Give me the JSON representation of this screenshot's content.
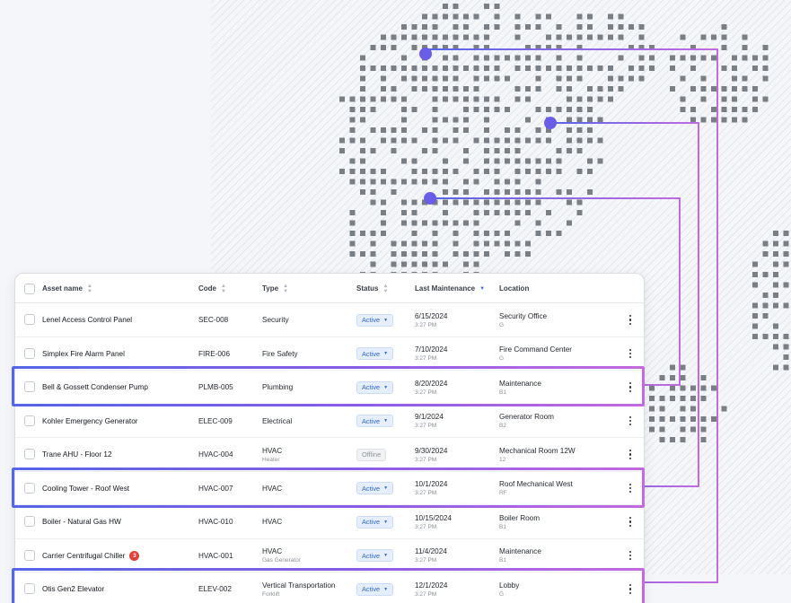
{
  "colors": {
    "accent_blue": "#5466e8",
    "accent_purple": "#9a5ce8",
    "status_active": "#2d67d6",
    "status_offline": "#8d939c",
    "alert_red": "#e4403a"
  },
  "table": {
    "headers": {
      "asset_name": "Asset name",
      "code": "Code",
      "type": "Type",
      "status": "Status",
      "last_maintenance": "Last Maintenance",
      "location": "Location"
    },
    "sorted_column": "last_maintenance",
    "rows": [
      {
        "name": "Lenel Access Control Panel",
        "code": "SEC-008",
        "type": "Security",
        "type_sub": "",
        "status": "Active",
        "date": "6/15/2024",
        "time": "3:27 PM",
        "location": "Security Office",
        "floor": "G",
        "badge": ""
      },
      {
        "name": "Simplex Fire Alarm Panel",
        "code": "FIRE-006",
        "type": "Fire Safety",
        "type_sub": "",
        "status": "Active",
        "date": "7/10/2024",
        "time": "3:27 PM",
        "location": "Fire Command Center",
        "floor": "G",
        "badge": ""
      },
      {
        "name": "Bell & Gossett Condenser Pump",
        "code": "PLMB-005",
        "type": "Plumbing",
        "type_sub": "",
        "status": "Active",
        "date": "8/20/2024",
        "time": "3:27 PM",
        "location": "Maintenance",
        "floor": "B1",
        "badge": ""
      },
      {
        "name": "Kohler Emergency Generator",
        "code": "ELEC-009",
        "type": "Electrical",
        "type_sub": "",
        "status": "Active",
        "date": "9/1/2024",
        "time": "3:27 PM",
        "location": "Generator Room",
        "floor": "B2",
        "badge": ""
      },
      {
        "name": "Trane AHU - Floor 12",
        "code": "HVAC-004",
        "type": "HVAC",
        "type_sub": "Heater",
        "status": "Offline",
        "date": "9/30/2024",
        "time": "3:27 PM",
        "location": "Mechanical Room 12W",
        "floor": "12",
        "badge": ""
      },
      {
        "name": "Cooling Tower - Roof West",
        "code": "HVAC-007",
        "type": "HVAC",
        "type_sub": "",
        "status": "Active",
        "date": "10/1/2024",
        "time": "3:27 PM",
        "location": "Roof Mechanical West",
        "floor": "RF",
        "badge": ""
      },
      {
        "name": "Boiler - Natural Gas HW",
        "code": "HVAC-010",
        "type": "HVAC",
        "type_sub": "",
        "status": "Active",
        "date": "10/15/2024",
        "time": "3:27 PM",
        "location": "Boiler Room",
        "floor": "B1",
        "badge": ""
      },
      {
        "name": "Carrier Centrifugal Chiller",
        "code": "HVAC-001",
        "type": "HVAC",
        "type_sub": "Gas Generator",
        "status": "Active",
        "date": "11/4/2024",
        "time": "3:27 PM",
        "location": "Maintenance",
        "floor": "B1",
        "badge": "3"
      },
      {
        "name": "Otis Gen2 Elevator",
        "code": "ELEV-002",
        "type": "Vertical Transportation",
        "type_sub": "Forklift",
        "status": "Active",
        "date": "12/1/2024",
        "time": "3:27 PM",
        "location": "Lobby",
        "floor": "G",
        "badge": ""
      }
    ],
    "highlighted_rows": [
      2,
      5,
      8
    ]
  }
}
